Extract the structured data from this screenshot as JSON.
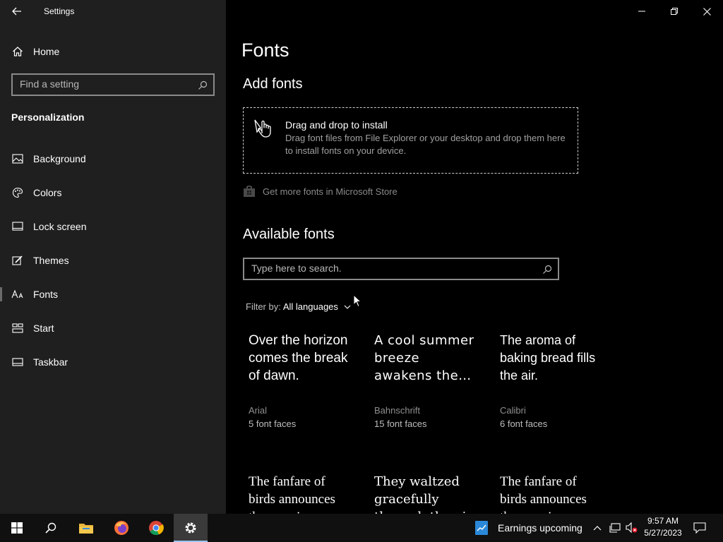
{
  "window": {
    "title": "Settings"
  },
  "sidebar": {
    "home_label": "Home",
    "search_placeholder": "Find a setting",
    "section_title": "Personalization",
    "items": [
      {
        "label": "Background",
        "icon": "image-icon"
      },
      {
        "label": "Colors",
        "icon": "palette-icon"
      },
      {
        "label": "Lock screen",
        "icon": "lock-screen-icon"
      },
      {
        "label": "Themes",
        "icon": "brush-icon"
      },
      {
        "label": "Fonts",
        "icon": "font-icon",
        "selected": true
      },
      {
        "label": "Start",
        "icon": "start-icon"
      },
      {
        "label": "Taskbar",
        "icon": "taskbar-icon"
      }
    ]
  },
  "main": {
    "page_title": "Fonts",
    "add_fonts": {
      "heading": "Add fonts",
      "drop_title": "Drag and drop to install",
      "drop_description": "Drag font files from File Explorer or your desktop and drop them here to install fonts on your device.",
      "store_link": "Get more fonts in Microsoft Store"
    },
    "available": {
      "heading": "Available fonts",
      "search_placeholder": "Type here to search.",
      "filter_label": "Filter by:",
      "filter_value": "All languages"
    },
    "fonts": [
      {
        "sample": "Over the horizon comes the break of dawn.",
        "name": "Arial",
        "faces": "5 font faces"
      },
      {
        "sample": "A cool summer breeze awakens the…",
        "name": "Bahnschrift",
        "faces": "15 font faces"
      },
      {
        "sample": "The aroma of baking bread fills the air.",
        "name": "Calibri",
        "faces": "6 font faces"
      },
      {
        "sample": "The fanfare of birds announces the morning.",
        "name": "",
        "faces": ""
      },
      {
        "sample": "They waltzed gracefully through the air.",
        "name": "",
        "faces": ""
      },
      {
        "sample": "The fanfare of birds announces the morning.",
        "name": "",
        "faces": ""
      }
    ]
  },
  "taskbar": {
    "news_text": "Earnings upcoming",
    "time": "9:57 AM",
    "date": "5/27/2023"
  },
  "colors": {
    "sidebar_bg": "#1f1f1f",
    "main_bg": "#000000",
    "taskbar_bg": "#101010",
    "accent_selected": "#6a6a6a"
  }
}
